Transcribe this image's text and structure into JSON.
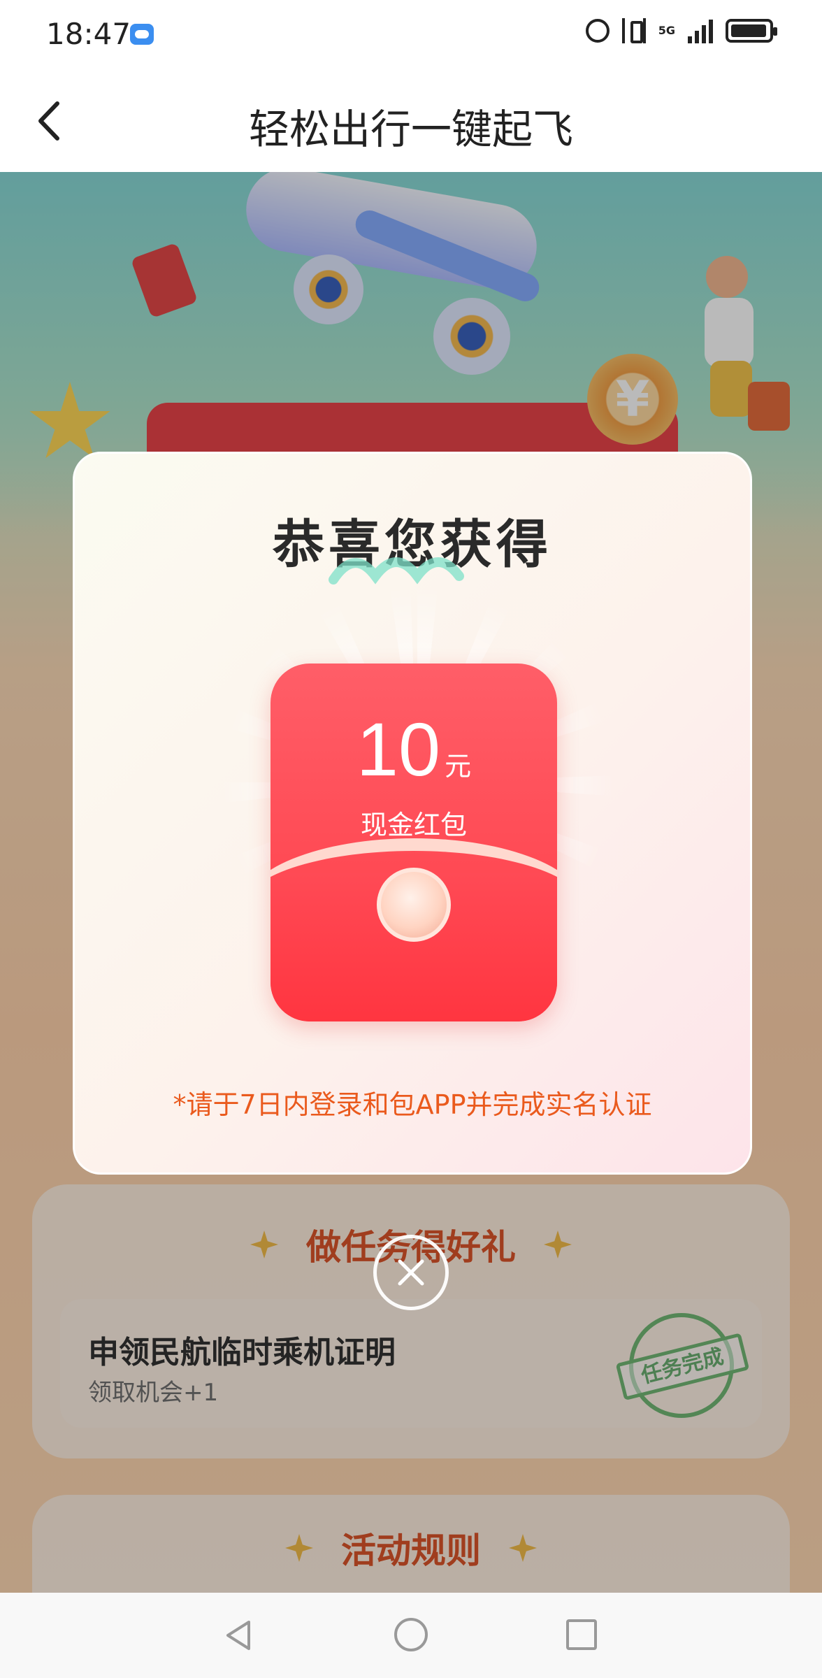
{
  "status_bar": {
    "time": "18:47",
    "network": "5G"
  },
  "nav": {
    "title": "轻松出行一键起飞"
  },
  "hero": {
    "coin_symbol": "¥"
  },
  "modal": {
    "title": "恭喜您获得",
    "reward": {
      "amount": "10",
      "unit": "元",
      "label": "现金红包"
    },
    "note": "*请于7日内登录和包APP并完成实名认证"
  },
  "tasks": {
    "title": "做任务得好礼",
    "items": [
      {
        "name": "申领民航临时乘机证明",
        "sub": "领取机会+1",
        "stamp": "任务完成"
      }
    ]
  },
  "rules": {
    "title": "活动规则"
  },
  "colors": {
    "accent_red": "#ff3b45",
    "note_orange": "#ea5a1d",
    "stamp_green": "#67b36b"
  },
  "icons": {
    "back": "chevron-left-icon",
    "close": "close-icon"
  }
}
